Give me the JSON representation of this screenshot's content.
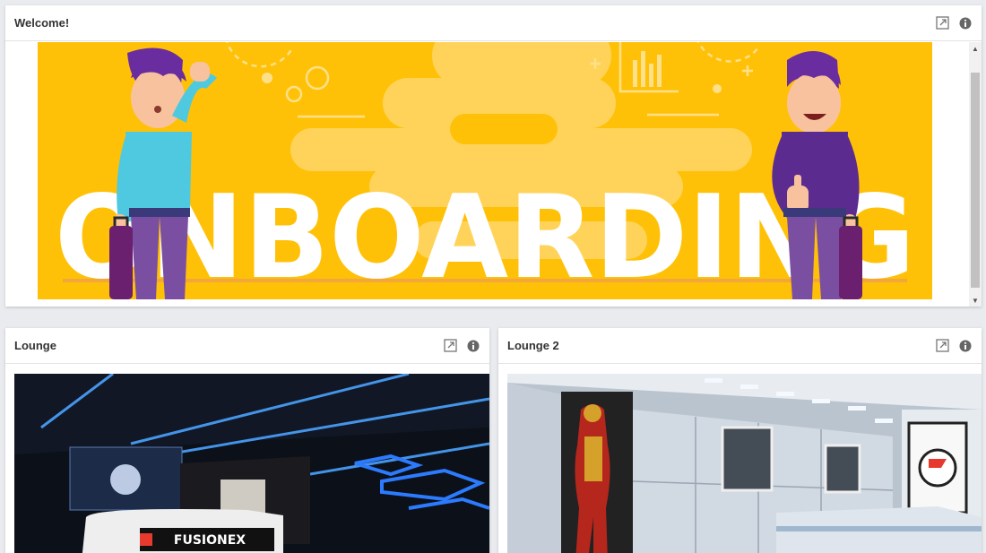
{
  "welcome": {
    "title": "Welcome!",
    "banner": {
      "text": "ONBOARDING",
      "colors": {
        "background": "#ffc107",
        "text": "#ffffff",
        "shirt_left": "#4ec9e0",
        "shirt_right": "#5c2b8f",
        "trousers": "#7a4fa1"
      }
    }
  },
  "lounge1": {
    "title": "Lounge",
    "sign_text": "FUSIONEX"
  },
  "lounge2": {
    "title": "Lounge 2"
  },
  "icons": {
    "expand": "expand-icon",
    "info": "info-icon"
  }
}
